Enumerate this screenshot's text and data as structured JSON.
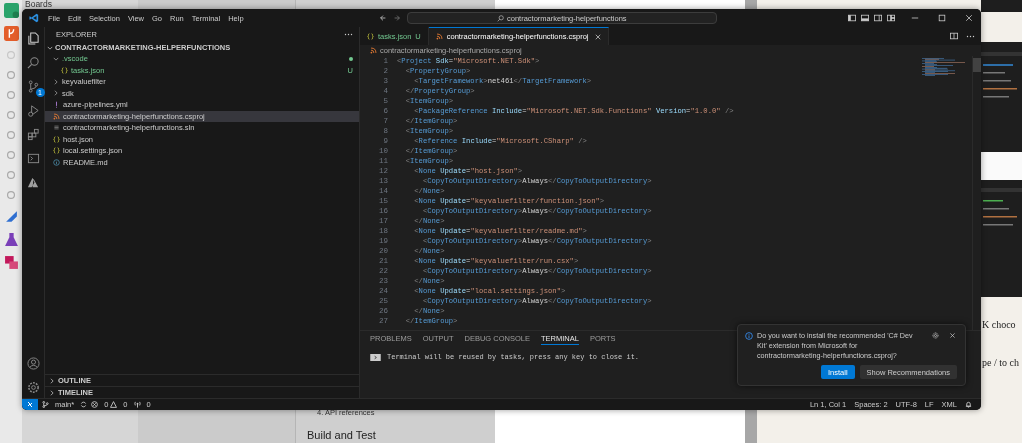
{
  "background": {
    "rail_label": "Boards",
    "doc_item": "4. API references",
    "doc_heading": "Build and Test",
    "side_texts": [
      "K choco",
      "pe / to ch"
    ]
  },
  "menu": [
    "File",
    "Edit",
    "Selection",
    "View",
    "Go",
    "Run",
    "Terminal",
    "Help"
  ],
  "search": {
    "value": "contractormarketing-helperfunctions"
  },
  "activity_bar": {
    "source_control_badge": "1"
  },
  "explorer": {
    "title": "EXPLORER",
    "root": {
      "label": "CONTRACTORMARKETING-HELPERFUNCTIONS",
      "expanded": true
    },
    "items": [
      {
        "label": ".vscode",
        "kind": "folder",
        "expanded": true,
        "untracked": true,
        "selected": false,
        "children": [
          {
            "label": "tasks.json",
            "kind": "json",
            "untracked": true,
            "badge": "U",
            "selected": false
          }
        ]
      },
      {
        "label": "keyvaluefilter",
        "kind": "folder",
        "expanded": false,
        "untracked": false,
        "selected": false
      },
      {
        "label": "sdk",
        "kind": "folder",
        "expanded": false,
        "untracked": false,
        "selected": false
      },
      {
        "label": "azure-pipelines.yml",
        "kind": "yaml",
        "untracked": false,
        "selected": false
      },
      {
        "label": "contractormarketing-helperfunctions.csproj",
        "kind": "xml",
        "untracked": false,
        "selected": true
      },
      {
        "label": "contractormarketing-helperfunctions.sln",
        "kind": "sln",
        "untracked": false,
        "selected": false
      },
      {
        "label": "host.json",
        "kind": "json",
        "untracked": false,
        "selected": false
      },
      {
        "label": "local.settings.json",
        "kind": "json",
        "untracked": false,
        "selected": false
      },
      {
        "label": "README.md",
        "kind": "markdown",
        "untracked": false,
        "selected": false
      }
    ]
  },
  "sections": [
    {
      "label": "OUTLINE",
      "expanded": false
    },
    {
      "label": "TIMELINE",
      "expanded": false
    }
  ],
  "tabs": [
    {
      "label": "tasks.json",
      "kind": "json",
      "badge": "U",
      "untracked": true,
      "selected": false
    },
    {
      "label": "contractormarketing-helperfunctions.csproj",
      "kind": "xml",
      "untracked": false,
      "selected": true
    }
  ],
  "breadcrumb": "contractormarketing-helperfunctions.csproj",
  "line_numbers": [
    "1",
    "2",
    "3",
    "4",
    "5",
    "6",
    "7",
    "8",
    "9",
    "10",
    "11",
    "12",
    "13",
    "14",
    "15",
    "16",
    "17",
    "18",
    "19",
    "20",
    "21",
    "22",
    "23",
    "24",
    "25",
    "26",
    "27"
  ],
  "code_lines": [
    "<Project Sdk=\"Microsoft.NET.Sdk\">",
    "  <PropertyGroup>",
    "    <TargetFramework>net461</TargetFramework>",
    "  </PropertyGroup>",
    "  <ItemGroup>",
    "    <PackageReference Include=\"Microsoft.NET.Sdk.Functions\" Version=\"1.0.0\" />",
    "  </ItemGroup>",
    "  <ItemGroup>",
    "    <Reference Include=\"Microsoft.CSharp\" />",
    "  </ItemGroup>",
    "  <ItemGroup>",
    "    <None Update=\"host.json\">",
    "      <CopyToOutputDirectory>Always</CopyToOutputDirectory>",
    "    </None>",
    "    <None Update=\"keyvaluefilter/function.json\">",
    "      <CopyToOutputDirectory>Always</CopyToOutputDirectory>",
    "    </None>",
    "    <None Update=\"keyvaluefilter/readme.md\">",
    "      <CopyToOutputDirectory>Always</CopyToOutputDirectory>",
    "    </None>",
    "    <None Update=\"keyvaluefilter/run.csx\">",
    "      <CopyToOutputDirectory>Always</CopyToOutputDirectory>",
    "    </None>",
    "    <None Update=\"local.settings.json\">",
    "      <CopyToOutputDirectory>Always</CopyToOutputDirectory>",
    "    </None>",
    "  </ItemGroup>"
  ],
  "panel": {
    "tabs": [
      {
        "label": "PROBLEMS",
        "selected": false
      },
      {
        "label": "OUTPUT",
        "selected": false
      },
      {
        "label": "DEBUG CONSOLE",
        "selected": false
      },
      {
        "label": "TERMINAL",
        "selected": true
      },
      {
        "label": "PORTS",
        "selected": false
      }
    ],
    "terminal_line": "Terminal will be reused by tasks, press any key to close it."
  },
  "notification": {
    "message": "Do you want to install the recommended 'C# Dev Kit' extension from Microsoft for contractormarketing-helperfunctions.csproj?",
    "buttons": [
      {
        "label": "Install",
        "kind": "primary"
      },
      {
        "label": "Show Recommendations",
        "kind": "secondary"
      }
    ]
  },
  "status_bar": {
    "branch": "main*",
    "errors": "0",
    "warnings": "0",
    "ports": "0",
    "right": [
      "Ln 1, Col 1",
      "Spaces: 2",
      "UTF-8",
      "LF",
      "XML"
    ]
  }
}
